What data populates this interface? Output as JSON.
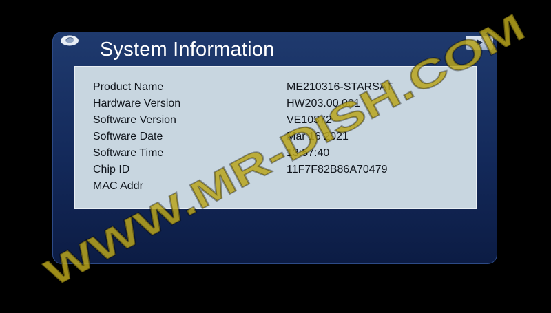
{
  "dialog": {
    "title": "System Information",
    "rows": [
      {
        "label": "Product Name",
        "value": "ME210316-STARSAT"
      },
      {
        "label": "Hardware Version",
        "value": "HW203.00.001"
      },
      {
        "label": "Software Version",
        "value": "VE10372"
      },
      {
        "label": "Software Date",
        "value": "Mar 16 2021"
      },
      {
        "label": "Software Time",
        "value": "13:57:40"
      },
      {
        "label": "Chip ID",
        "value": "11F7F82B86A70479"
      },
      {
        "label": "MAC Addr",
        "value": ""
      }
    ]
  },
  "watermark": {
    "text": "WWW.MR-DISH.COM",
    "color": "#b9a41c"
  },
  "icons": {
    "logo": "disc-logo-icon",
    "nav": "play-arrow-icon"
  }
}
